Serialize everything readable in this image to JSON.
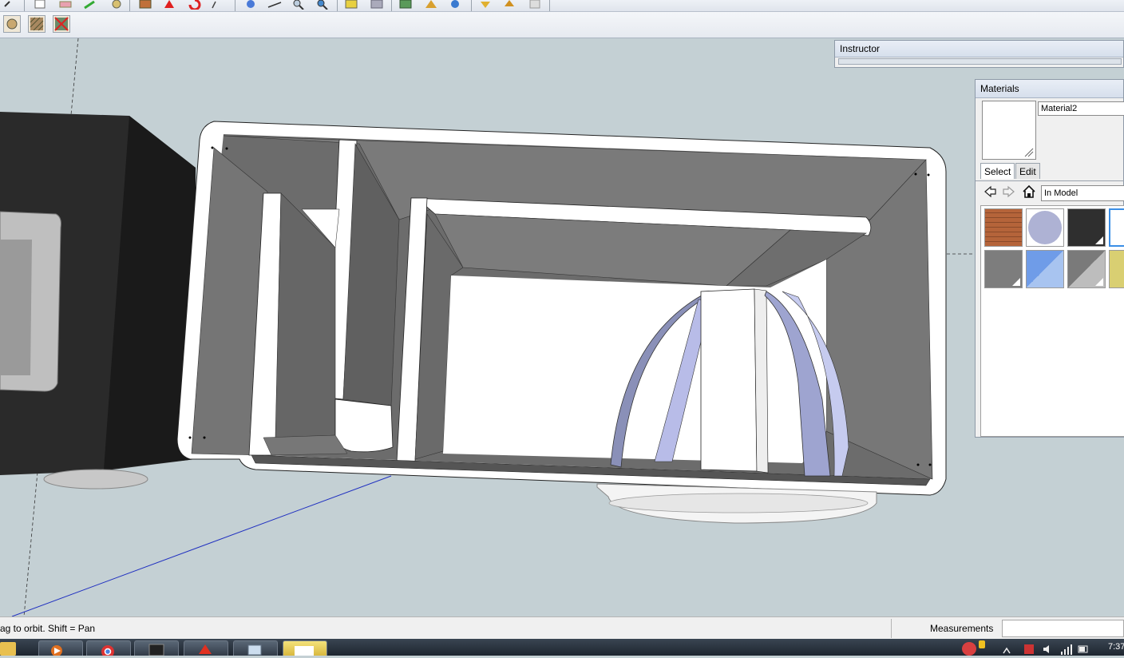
{
  "toolbar": {
    "row1_icons": [
      "undo-icon",
      "new-icon",
      "eraser-icon",
      "paint-icon",
      "orbit-icon",
      "component-icon",
      "tape-icon",
      "rotate-icon",
      "follow-me-icon",
      "orbit-tool-icon",
      "pan-icon",
      "zoom-icon",
      "zoom-window-icon",
      "push-pull-icon",
      "offset-icon",
      "material-icon",
      "section-icon",
      "view-icon",
      "import-icon",
      "export-icon",
      "layer-icon"
    ],
    "row2_icons": [
      "circle-face-icon",
      "hatch-icon",
      "x-mark-icon"
    ]
  },
  "instructor": {
    "title": "Instructor"
  },
  "materials": {
    "title": "Materials",
    "material_name": "Material2",
    "tabs": {
      "select": "Select",
      "edit": "Edit"
    },
    "collection": "In Model",
    "swatches": [
      {
        "name": "brick-swatch",
        "color": "#b5643a"
      },
      {
        "name": "lavender-swatch",
        "color": "#aeb2d4"
      },
      {
        "name": "dark-gray-swatch",
        "color": "#2f2f2f"
      },
      {
        "name": "white-swatch",
        "color": "#ffffff"
      },
      {
        "name": "stone-swatch",
        "color": "#7d7d7d"
      },
      {
        "name": "blue-swatch",
        "color": "#6f9ce8"
      },
      {
        "name": "gray-swatch",
        "color": "#9a9a9a"
      },
      {
        "name": "yellow-swatch",
        "color": "#d9cf72"
      }
    ]
  },
  "status": {
    "hint": "ag to orbit.  Shift = Pan",
    "measurements_label": "Measurements"
  },
  "taskbar": {
    "clock": "7:37"
  }
}
